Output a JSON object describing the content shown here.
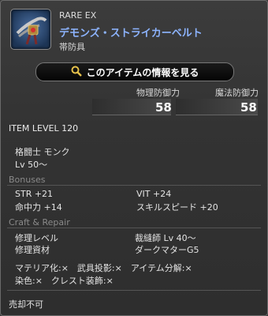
{
  "header": {
    "rarity": "RARE EX",
    "name": "デモンズ・ストライカーベルト",
    "type": "帯防具",
    "info_button": "このアイテムの情報を見る"
  },
  "defense": {
    "physical_label": "物理防御力",
    "physical_value": "58",
    "magic_label": "魔法防御力",
    "magic_value": "58"
  },
  "item_level": "ITEM LEVEL 120",
  "class_info": {
    "classes": "格闘士 モンク",
    "level": "Lv 50～"
  },
  "bonuses": {
    "heading": "Bonuses",
    "str": "STR +21",
    "vit": "VIT +24",
    "accuracy": "命中力 +14",
    "skill_speed": "スキルスピード +20"
  },
  "craft": {
    "heading": "Craft & Repair",
    "repair_level_label": "修理レベル",
    "repair_level_value": "裁縫師 Lv 40～",
    "repair_material_label": "修理資材",
    "repair_material_value": "ダークマターG5",
    "flags_line1": "マテリア化:×　武具投影:×　アイテム分解:×",
    "flags_line2": "染色:×　クレスト装飾:×"
  },
  "footer": {
    "unsellable": "売却不可"
  },
  "colors": {
    "name_color": "#8db4ff",
    "section_heading_color": "#8a8a8a"
  },
  "icons": {
    "item": "belt-item-icon",
    "search": "magnifier-icon"
  }
}
